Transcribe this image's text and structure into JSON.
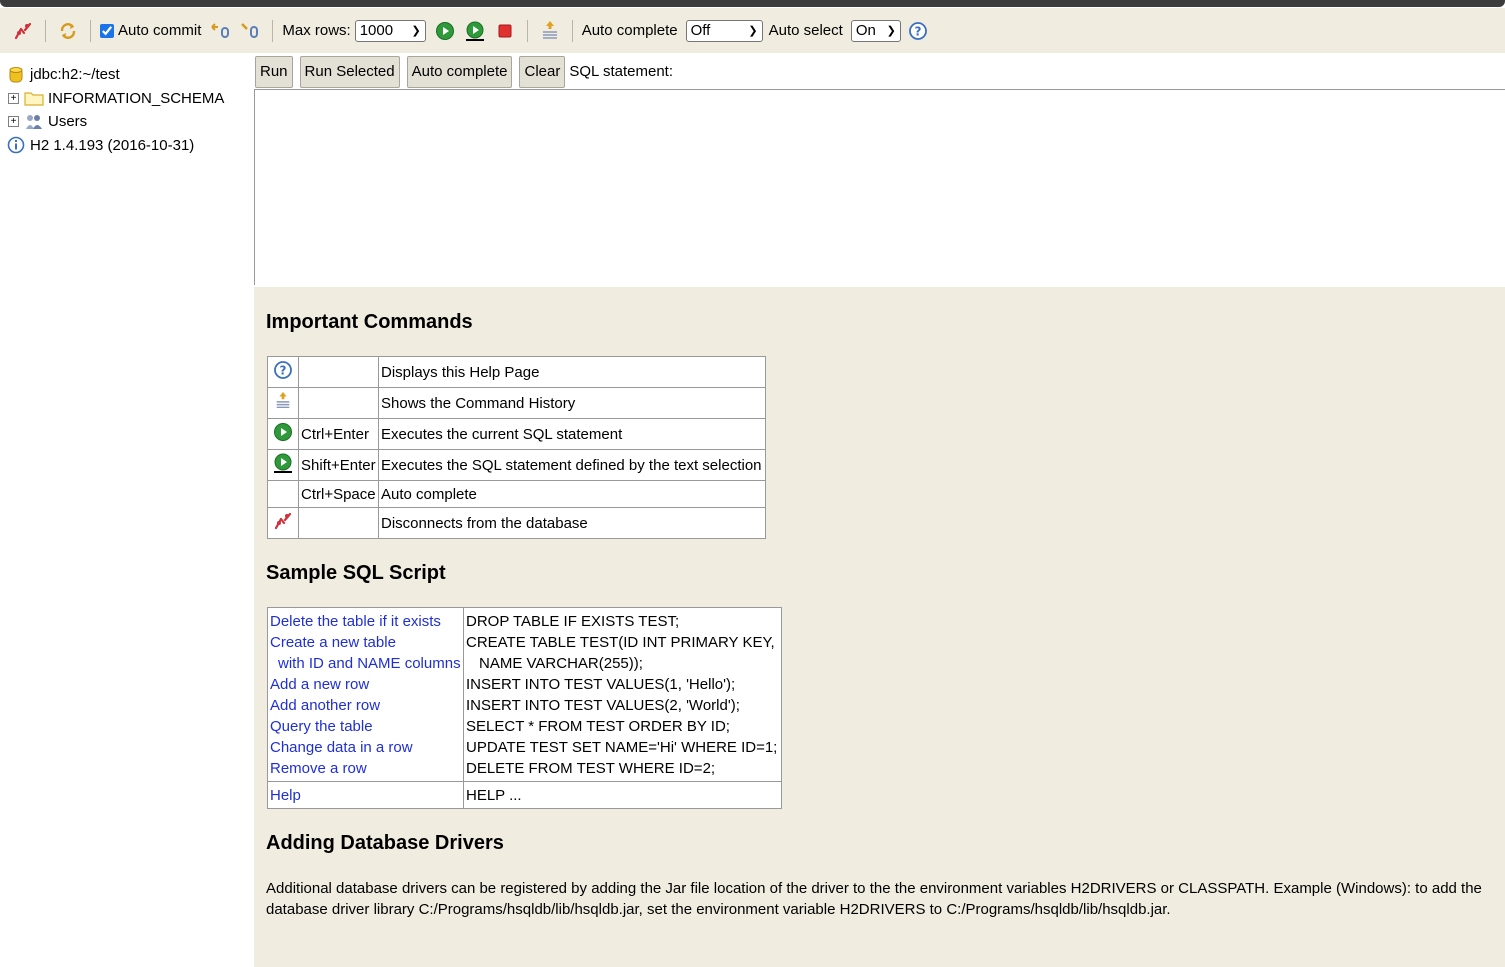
{
  "toolbar": {
    "icons": [
      "disconnect-icon",
      "refresh-icon",
      "rollback-icon",
      "commit-icon",
      "run-icon",
      "run-selected-icon",
      "stop-icon",
      "history-icon",
      "help-icon"
    ],
    "auto_commit_label": "Auto commit",
    "auto_commit_checked": true,
    "max_rows_label": "Max rows:",
    "max_rows_value": "1000",
    "auto_complete_label": "Auto complete",
    "auto_complete_value": "Off",
    "auto_select_label": "Auto select",
    "auto_select_value": "On"
  },
  "tree": {
    "connection": "jdbc:h2:~/test",
    "items": [
      {
        "label": "INFORMATION_SCHEMA",
        "icon": "folder-icon"
      },
      {
        "label": "Users",
        "icon": "users-icon"
      }
    ],
    "version": "H2 1.4.193 (2016-10-31)"
  },
  "query": {
    "run_label": "Run",
    "run_selected_label": "Run Selected",
    "auto_complete_label": "Auto complete",
    "clear_label": "Clear",
    "statement_label": "SQL statement:",
    "statement_value": ""
  },
  "help": {
    "important_title": "Important Commands",
    "commands": [
      {
        "icon": "help-icon",
        "key": "",
        "desc": "Displays this Help Page"
      },
      {
        "icon": "history-icon",
        "key": "",
        "desc": "Shows the Command History"
      },
      {
        "icon": "run-icon",
        "key": "Ctrl+Enter",
        "desc": "Executes the current SQL statement"
      },
      {
        "icon": "run-selected-icon",
        "key": "Shift+Enter",
        "desc": "Executes the SQL statement defined by the text selection"
      },
      {
        "icon": "",
        "key": "Ctrl+Space",
        "desc": "Auto complete"
      },
      {
        "icon": "disconnect-icon",
        "key": "",
        "desc": "Disconnects from the database"
      }
    ],
    "sample_title": "Sample SQL Script",
    "sample_links": [
      "Delete the table if it exists",
      "Create a new table",
      "with ID and NAME columns",
      "Add a new row",
      "Add another row",
      "Query the table",
      "Change data in a row",
      "Remove a row"
    ],
    "sample_sql": [
      "DROP TABLE IF EXISTS TEST;",
      "CREATE TABLE TEST(ID INT PRIMARY KEY,",
      "NAME VARCHAR(255));",
      "INSERT INTO TEST VALUES(1, 'Hello');",
      "INSERT INTO TEST VALUES(2, 'World');",
      "SELECT * FROM TEST ORDER BY ID;",
      "UPDATE TEST SET NAME='Hi' WHERE ID=1;",
      "DELETE FROM TEST WHERE ID=2;"
    ],
    "help_link": "Help",
    "help_sql": "HELP ...",
    "drivers_title": "Adding Database Drivers",
    "drivers_text": "Additional database drivers can be registered by adding the Jar file location of the driver to the the environment variables H2DRIVERS or CLASSPATH. Example (Windows): to add the database driver library C:/Programs/hsqldb/lib/hsqldb.jar, set the environment variable H2DRIVERS to C:/Programs/hsqldb/lib/hsqldb.jar."
  }
}
